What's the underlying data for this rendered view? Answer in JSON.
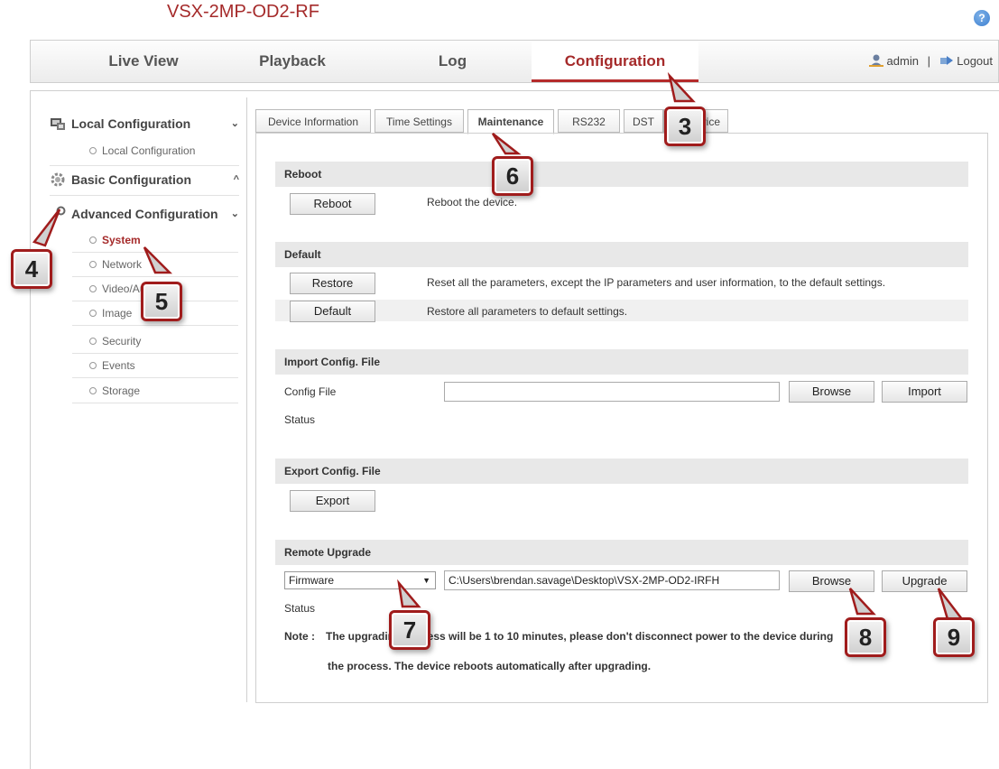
{
  "header": {
    "device_name": "VSX-2MP-OD2-RF",
    "help_glyph": "?"
  },
  "topnav": {
    "tabs": [
      {
        "label": "Live View"
      },
      {
        "label": "Playback"
      },
      {
        "label": "Log"
      },
      {
        "label": "Configuration",
        "active": true
      }
    ],
    "user": "admin",
    "separator": "|",
    "logout": "Logout"
  },
  "sidebar": {
    "local_config": {
      "label": "Local Configuration",
      "chevron": "⌄",
      "items": [
        "Local Configuration"
      ]
    },
    "basic_config": {
      "label": "Basic Configuration",
      "chevron": "^"
    },
    "advanced_config": {
      "label": "Advanced Configuration",
      "chevron": "⌄",
      "items": [
        "System",
        "Network",
        "Video/Audio",
        "Image",
        "Security",
        "Events",
        "Storage"
      ],
      "active_item": "System"
    }
  },
  "content_tabs": [
    "Device Information",
    "Time Settings",
    "Maintenance",
    "RS232",
    "DST",
    "Service"
  ],
  "active_content_tab": "Maintenance",
  "reboot": {
    "title": "Reboot",
    "button": "Reboot",
    "desc": "Reboot the device."
  },
  "default": {
    "title": "Default",
    "restore_button": "Restore",
    "restore_desc": "Reset all the parameters, except the IP parameters and user information, to the default settings.",
    "default_button": "Default",
    "default_desc": "Restore all parameters to default settings."
  },
  "import": {
    "title": "Import Config. File",
    "config_label": "Config File",
    "config_value": "",
    "browse": "Browse",
    "import": "Import",
    "status_label": "Status"
  },
  "export": {
    "title": "Export Config. File",
    "button": "Export"
  },
  "upgrade": {
    "title": "Remote Upgrade",
    "type_value": "Firmware",
    "type_arrow": "▼",
    "path_value": "C:\\Users\\brendan.savage\\Desktop\\VSX-2MP-OD2-IRFH",
    "browse": "Browse",
    "upgrade": "Upgrade",
    "status_label": "Status",
    "note_label": "Note :",
    "note_line1": "The upgrading process will be 1 to 10 minutes, please don't disconnect power to the device during",
    "note_line2": "the process. The device reboots automatically after upgrading."
  },
  "callouts": [
    "3",
    "4",
    "5",
    "6",
    "7",
    "8",
    "9"
  ],
  "colors": {
    "accent": "#a52a2a",
    "callout_border": "#a01c1c"
  }
}
